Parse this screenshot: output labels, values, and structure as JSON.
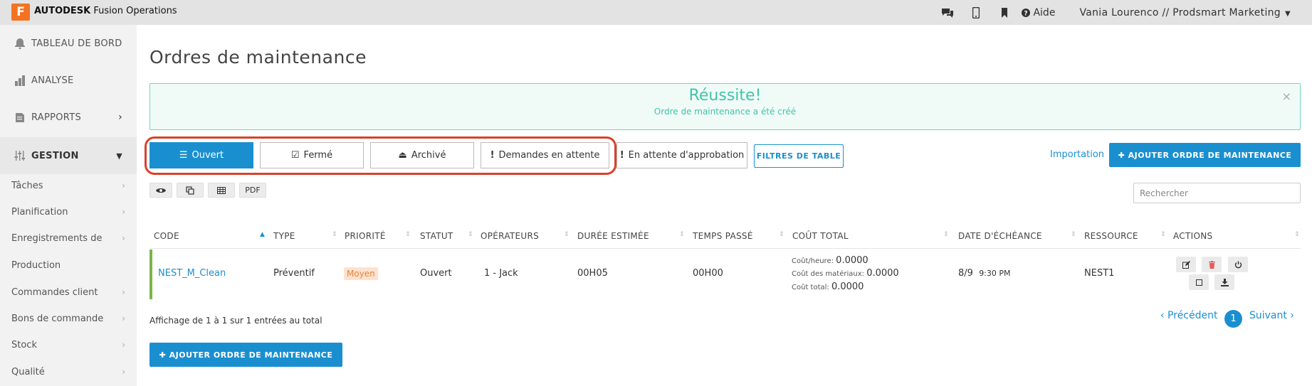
{
  "topbar": {
    "logo_letter": "F",
    "brand_bold": "AUTODESK",
    "brand_rest": "Fusion Operations",
    "icons": [
      "comments-icon",
      "mobile-icon",
      "bookmark-icon"
    ],
    "help_label": "Aide",
    "user": "Vania Lourenco // Prodsmart Marketing"
  },
  "sidebar": {
    "main": [
      {
        "label": "TABLEAU DE BORD",
        "icon": "bell-icon"
      },
      {
        "label": "ANALYSE",
        "icon": "bar-chart-icon"
      },
      {
        "label": "RAPPORTS",
        "icon": "document-icon"
      },
      {
        "label": "GESTION",
        "icon": "sliders-icon"
      }
    ],
    "sub": [
      {
        "label": "Tâches"
      },
      {
        "label": "Planification"
      },
      {
        "label": "Enregistrements de"
      },
      {
        "label": "Production"
      },
      {
        "label": "Commandes client"
      },
      {
        "label": "Bons de commande"
      },
      {
        "label": "Stock"
      },
      {
        "label": "Qualité"
      }
    ]
  },
  "page": {
    "title": "Ordres de maintenance",
    "alert_title": "Réussite!",
    "alert_message": "Ordre de maintenance a été créé",
    "alert_close": "×"
  },
  "tabs": [
    {
      "label": "Ouvert",
      "icon": "list-icon",
      "glyph": "☰"
    },
    {
      "label": "Fermé",
      "icon": "check-square-icon",
      "glyph": "☑"
    },
    {
      "label": "Archivé",
      "icon": "inbox-icon",
      "glyph": "⏏"
    },
    {
      "label": "Demandes en attente",
      "icon": "exclamation-icon",
      "glyph": "!"
    },
    {
      "label": "En attente d'approbation",
      "icon": "exclamation-icon",
      "glyph": "!"
    }
  ],
  "toolbar": {
    "filters_label": "FILTRES DE TABLE",
    "import_label": "Importation",
    "add_label": "✚ AJOUTER ORDRE DE MAINTENANCE",
    "pdf_label": "PDF",
    "search_placeholder": "Rechercher"
  },
  "table": {
    "headers": [
      "CODE",
      "TYPE",
      "PRIORITÉ",
      "STATUT",
      "OPÉRATEURS",
      "DURÉE ESTIMÉE",
      "TEMPS PASSÉ",
      "COÛT TOTAL",
      "DATE D'ÉCHÉANCE",
      "RESSOURCE",
      "ACTIONS"
    ],
    "row": {
      "code": "NEST_M_Clean",
      "type": "Préventif",
      "priority": "Moyen",
      "status": "Ouvert",
      "operators": "1 - Jack",
      "estimated": "00H05",
      "spent": "00H00",
      "cost_hour_label": "Coût/heure:",
      "cost_hour": "0.0000",
      "cost_materials_label": "Coût des matériaux:",
      "cost_materials": "0.0000",
      "cost_total_label": "Coût total:",
      "cost_total": "0.0000",
      "due_date": "8/9",
      "due_time": "9:30 PM",
      "resource": "NEST1"
    }
  },
  "footer": {
    "entries_text": "Affichage de 1 à 1 sur 1 entrées au total",
    "prev_label": "‹ Précédent",
    "page": "1",
    "next_label": "Suivant ›",
    "add_label": "✚ AJOUTER ORDRE DE MAINTENANCE"
  },
  "colors": {
    "primary": "#1a8fd0",
    "success": "#42c5a6",
    "highlight": "#d9412b",
    "brand_orange": "#f37321",
    "row_marker": "#7ab648"
  }
}
